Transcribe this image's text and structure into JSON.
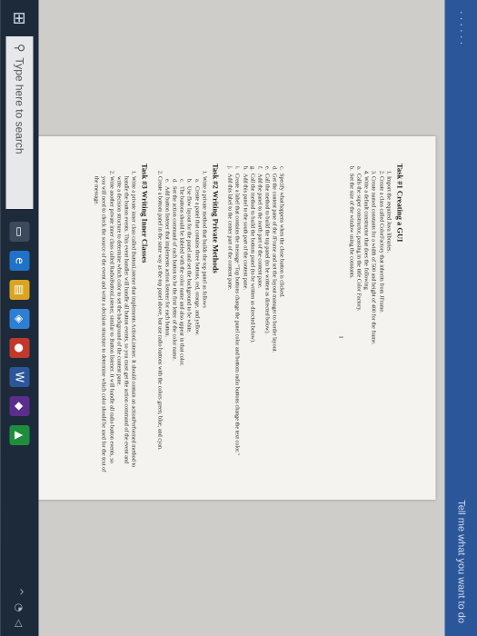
{
  "ribbon": {
    "tell_me": "Tell me what you want to do"
  },
  "taskbar": {
    "search_placeholder": "Type here to search"
  },
  "document": {
    "task1": {
      "title": "Task #1 Creating a GUI",
      "items": [
        "Import the required Java libraries.",
        "Create a class called ColorFactory that inherits from JFrame.",
        "Create named constants for a width of 500 and height of 400 for the frame.",
        "Write a default constructor that does the following"
      ],
      "subitems": [
        {
          "label": "a.",
          "text": "Calls the super constructor, passing in the title Color Factory."
        },
        {
          "label": "b.",
          "text": "Set the size of the window using the constants."
        }
      ],
      "cursor_mark": "I"
    },
    "task1_cont": {
      "items": [
        {
          "label": "c.",
          "text": "Specify what happens when the close button is clicked."
        },
        {
          "label": "d.",
          "text": "Get the content pane of the JFrame and set the layout manager to border layout."
        },
        {
          "label": "e.",
          "text": "Call the method to build the top panel (to be written as directed below)."
        },
        {
          "label": "f.",
          "text": "Add the panel to the north part of the content pane."
        },
        {
          "label": "g.",
          "text": "Call the method to build the bottom panel (to be written as directed below)."
        },
        {
          "label": "h.",
          "text": "Add this panel to the south part of the content pane."
        },
        {
          "label": "i.",
          "text": "Create a label that contains the message \"Top buttons change the panel color and bottom radio buttons change the text color.\""
        },
        {
          "label": "j.",
          "text": "Add this label to the center part of the content pane."
        }
      ]
    },
    "task2": {
      "title": "Task #2 Writing Private Methods",
      "item1": "Write a private method that builds the top panel as follows",
      "subitems": [
        {
          "label": "a.",
          "text": "Create a panel that contains three buttons, red, orange, and yellow."
        },
        {
          "label": "b.",
          "text": "Use flow layout for the panel and set the background to be white."
        },
        {
          "label": "c.",
          "text": "The buttons should be labeled with the color name and also appear in that color."
        },
        {
          "label": "d.",
          "text": "Set the action command of each button to be the first letter of the color name."
        },
        {
          "label": "e.",
          "text": "Add button listener that implements action listener for each button."
        }
      ],
      "item2": "Create a bottom panel in the same way as the top panel above, but use radio buttons with the colors green, blue, and cyan."
    },
    "task3": {
      "title": "Task #3 Writing Inner Classes",
      "item1": "Write a private inner class called ButtonListener that implements ActionListener. It should contain an actionPerformed method to handle the button events. This event handler will handle all button events, so you must get the action command of the event and write a decision structure to determine which color to set the background of the content pane.",
      "item2": "Write another private inner class called RadioButtonListener, similar to Button listener. It will handle all radio button events, so you will need to check the source of the event and write a decision structure to determine which color should be used for the text of the message."
    }
  }
}
